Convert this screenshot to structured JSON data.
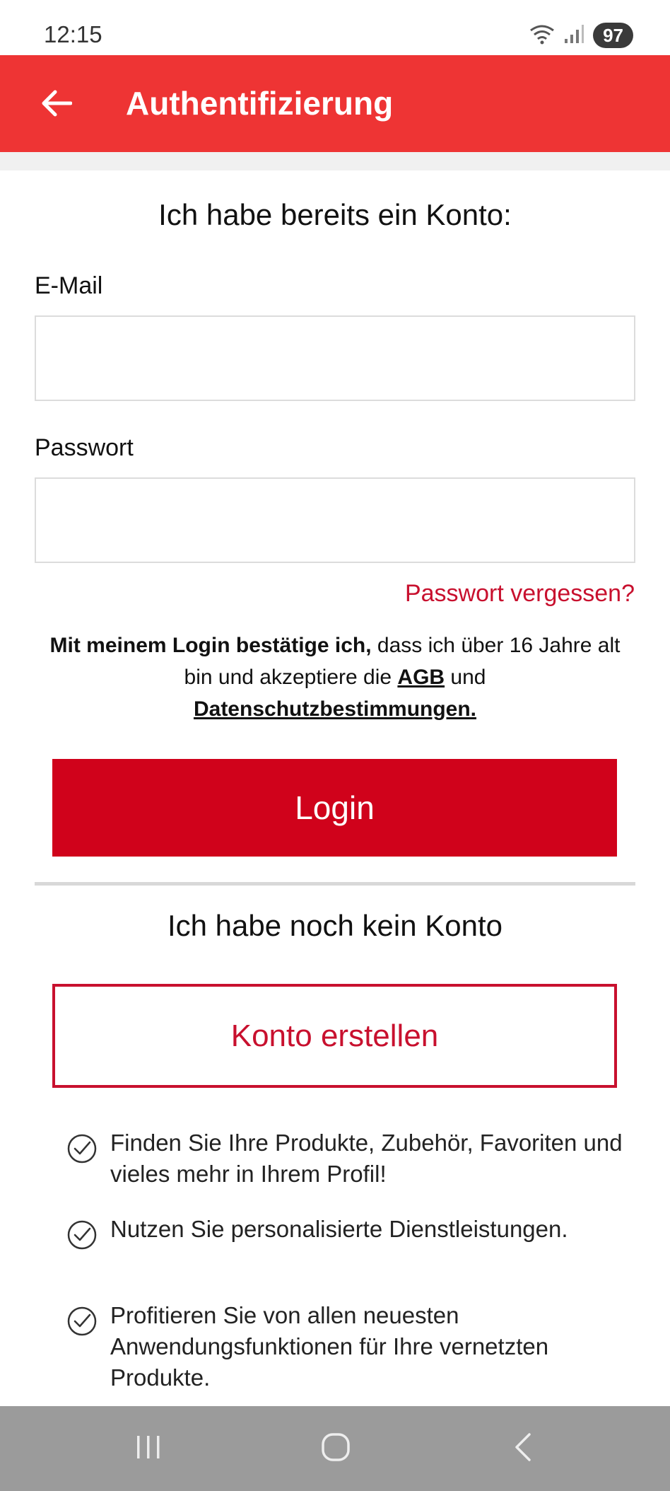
{
  "status_bar": {
    "time": "12:15",
    "battery": "97",
    "wifi_icon": "wifi-icon",
    "signal_icon": "signal-icon"
  },
  "app_bar": {
    "title": "Authentifizierung",
    "back_icon": "arrow-left-icon",
    "color": "#ee3434"
  },
  "login": {
    "heading": "Ich habe bereits ein Konto:",
    "email_label": "E-Mail",
    "email_value": "",
    "password_label": "Passwort",
    "password_value": "",
    "forgot_password": "Passwort vergessen?",
    "legal_bold": "Mit meinem Login bestätige ich,",
    "legal_text_1": " dass ich über 16 Jahre alt bin und akzeptiere die ",
    "legal_agb": "AGB",
    "legal_text_2": " und ",
    "legal_privacy": "Datenschutzbestimmungen.",
    "login_button": "Login",
    "button_color": "#d0021b"
  },
  "register": {
    "heading": "Ich habe noch kein Konto",
    "create_button": "Konto erstellen",
    "benefits": [
      "Finden Sie Ihre Produkte, Zubehör, Favoriten und vieles mehr in Ihrem Profil!",
      "Nutzen Sie personalisierte Dienstleistungen.",
      "Profitieren Sie von allen neuesten Anwendungsfunktionen für Ihre vernetzten Produkte."
    ]
  },
  "nav_bar": {
    "recents_icon": "recents-icon",
    "home_icon": "home-icon",
    "back_icon": "back-icon"
  }
}
